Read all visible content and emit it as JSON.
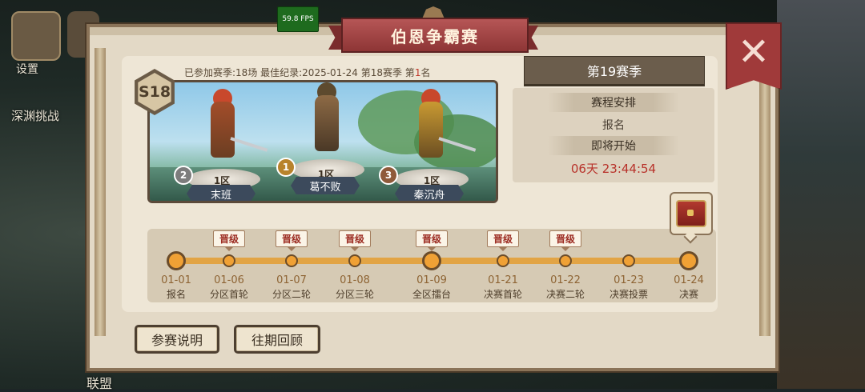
{
  "background": {
    "left_label_1": "设置",
    "left_label_2": "深渊挑战",
    "bottom_label": "联盟"
  },
  "fps": "59.8 FPS",
  "title": "伯恩争霸赛",
  "close_label": "✕",
  "season_badge": "S18",
  "stats": {
    "prefix": "已参加赛季:18场 最佳纪录:2025-01-24 第18赛季 第",
    "rank": "1",
    "suffix": "名"
  },
  "podium": [
    {
      "rank": "2",
      "server": "1区",
      "name": "末班"
    },
    {
      "rank": "1",
      "server": "1区",
      "name": "葛不败"
    },
    {
      "rank": "3",
      "server": "1区",
      "name": "秦沉舟"
    }
  ],
  "season_title": "第19赛季",
  "schedule": {
    "header": "赛程安排",
    "value": "报名",
    "start_header": "即将开始",
    "countdown": "06天 23:44:54"
  },
  "timeline": [
    {
      "date": "01-01",
      "label": "报名",
      "promo": "",
      "size": "big"
    },
    {
      "date": "01-06",
      "label": "分区首轮",
      "promo": "晋级",
      "size": "small"
    },
    {
      "date": "01-07",
      "label": "分区二轮",
      "promo": "晋级",
      "size": "small"
    },
    {
      "date": "01-08",
      "label": "分区三轮",
      "promo": "晋级",
      "size": "small"
    },
    {
      "date": "01-09",
      "label": "全区擂台",
      "promo": "晋级",
      "size": "big"
    },
    {
      "date": "01-21",
      "label": "决赛首轮",
      "promo": "晋级",
      "size": "small"
    },
    {
      "date": "01-22",
      "label": "决赛二轮",
      "promo": "晋级",
      "size": "small"
    },
    {
      "date": "01-23",
      "label": "决赛投票",
      "promo": "",
      "size": "small"
    },
    {
      "date": "01-24",
      "label": "决赛",
      "promo": "",
      "size": "big"
    }
  ],
  "buttons": {
    "rules": "参赛说明",
    "history": "往期回顾"
  },
  "colors": {
    "title_red": "#9e3c3c",
    "track_orange": "#f0a135",
    "countdown_red": "#b8322a"
  }
}
